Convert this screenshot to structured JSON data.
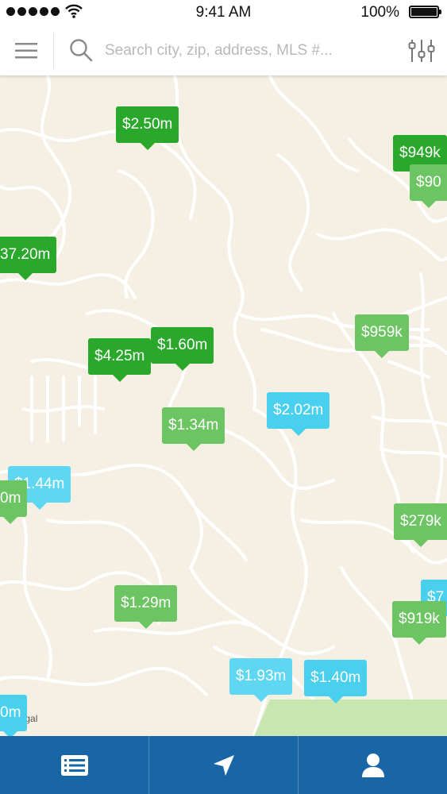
{
  "status_bar": {
    "time": "9:41 AM",
    "battery_percent": "100%",
    "signal_icon": "signal-dots-icon",
    "wifi_icon": "wifi-icon",
    "battery_icon": "battery-icon"
  },
  "search": {
    "placeholder": "Search city, zip, address, MLS #...",
    "menu_icon": "hamburger-menu-icon",
    "search_icon": "search-icon",
    "filter_icon": "sliders-filter-icon"
  },
  "map": {
    "legal_label": "Legal",
    "listings": [
      {
        "price": "$2.50m",
        "style": "dark"
      },
      {
        "price": "$949k",
        "style": "dark"
      },
      {
        "price": "$90",
        "style": "light"
      },
      {
        "price": "37.20m",
        "style": "dark"
      },
      {
        "price": "$4.25m",
        "style": "dark"
      },
      {
        "price": "$1.60m",
        "style": "dark"
      },
      {
        "price": "$959k",
        "style": "light"
      },
      {
        "price": "$2.02m",
        "style": "blue"
      },
      {
        "price": "$1.34m",
        "style": "light"
      },
      {
        "price": "$1.44m",
        "style": "blue2"
      },
      {
        "price": "0m",
        "style": "light"
      },
      {
        "price": "$279k",
        "style": "light"
      },
      {
        "price": "$7",
        "style": "blue"
      },
      {
        "price": "$919k",
        "style": "light"
      },
      {
        "price": "$1.29m",
        "style": "light"
      },
      {
        "price": "$1.93m",
        "style": "blue2"
      },
      {
        "price": "$1.40m",
        "style": "blue"
      },
      {
        "price": "0m",
        "style": "blue"
      }
    ]
  },
  "tab_bar": {
    "tabs": [
      {
        "name": "list-view",
        "icon": "list-icon"
      },
      {
        "name": "location",
        "icon": "location-arrow-icon"
      },
      {
        "name": "profile",
        "icon": "user-icon"
      }
    ]
  },
  "colors": {
    "map_background": "#f6efe3",
    "road": "#ffffff",
    "pin_dark_green": "#2aa82b",
    "pin_light_green": "#6dc463",
    "pin_blue": "#48d0ee",
    "tab_bar": "#1966a6",
    "park": "#c7e6b0"
  }
}
